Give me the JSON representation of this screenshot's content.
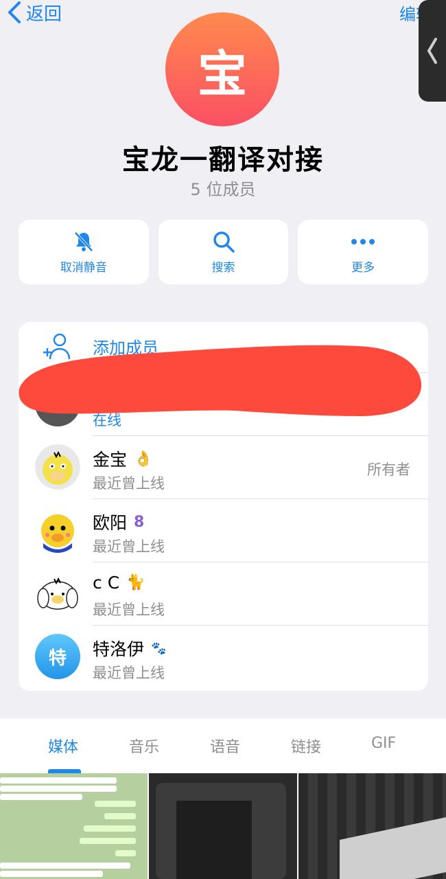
{
  "nav": {
    "back_label": "返回",
    "edit_label": "编辑"
  },
  "group": {
    "avatar_char": "宝",
    "title": "宝龙一翻译对接",
    "member_count": "5 位成员"
  },
  "actions": [
    {
      "label": "取消静音",
      "icon": "bell-slash-icon"
    },
    {
      "label": "搜索",
      "icon": "search-icon"
    },
    {
      "label": "更多",
      "icon": "more-dots-icon"
    }
  ],
  "add_member_label": "添加成员",
  "members": [
    {
      "name": "",
      "status": "在线",
      "role": ""
    },
    {
      "name": "金宝",
      "emoji": "👌",
      "status": "最近曾上线",
      "role": "所有者"
    },
    {
      "name": "欧阳",
      "emoji": "8",
      "status": "最近曾上线",
      "role": ""
    },
    {
      "name": "c C",
      "emoji": "🐈",
      "status": "最近曾上线",
      "role": ""
    },
    {
      "name": "特洛伊",
      "emoji": "🐾",
      "avatar_char": "特",
      "status": "最近曾上线",
      "role": ""
    }
  ],
  "tabs": [
    "媒体",
    "音乐",
    "语音",
    "链接",
    "GIF"
  ],
  "active_tab": "媒体",
  "colors": {
    "accent": "#1f87ec",
    "redaction": "#fd4a3d"
  }
}
